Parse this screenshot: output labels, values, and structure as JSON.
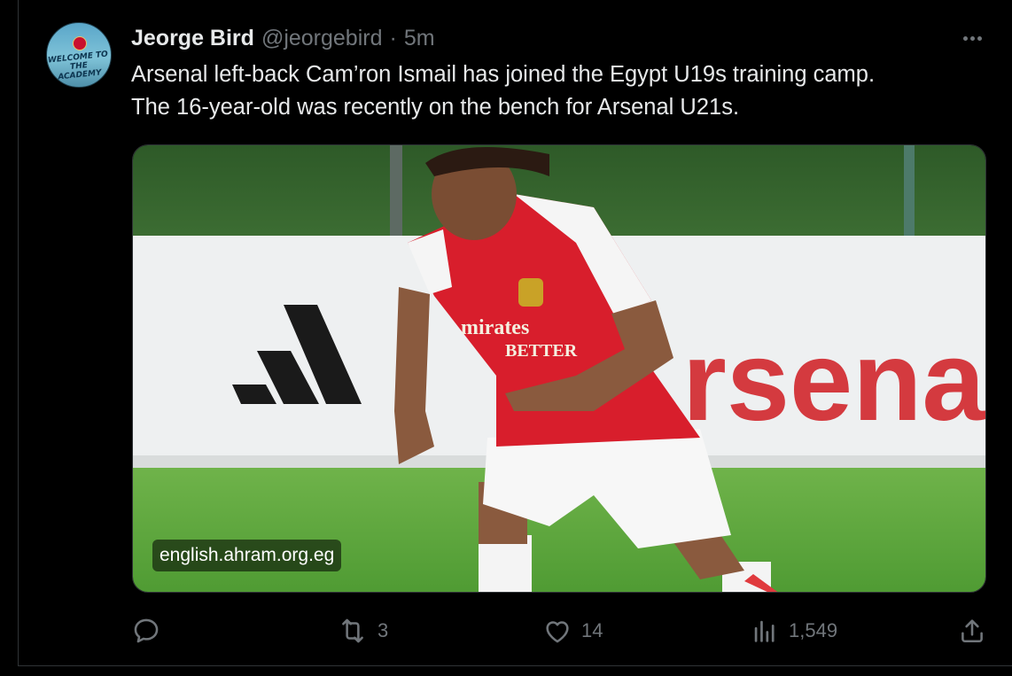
{
  "tweet": {
    "author_name": "Jeorge Bird",
    "handle": "@jeorgebird",
    "separator": "·",
    "time": "5m",
    "lines": [
      "Arsenal left-back Cam’ron Ismail has joined the Egypt U19s training camp.",
      "The 16-year-old was recently on the bench for Arsenal U21s."
    ],
    "avatar": {
      "sign_text": "WELCOME TO THE ACADEMY"
    },
    "media": {
      "source_label": "english.ahram.org.eg",
      "banner_text": "rsena",
      "shirt_text_1": "mirates",
      "shirt_text_2": "BETTER"
    }
  },
  "actions": {
    "reply": {
      "icon": "reply-icon",
      "count": ""
    },
    "retweet": {
      "icon": "retweet-icon",
      "count": "3"
    },
    "like": {
      "icon": "heart-icon",
      "count": "14"
    },
    "views": {
      "icon": "views-icon",
      "count": "1,549"
    },
    "share": {
      "icon": "share-icon"
    }
  },
  "colors": {
    "background": "#000000",
    "text_primary": "#e7e9ea",
    "text_secondary": "#71767b",
    "arsenal_red": "#c8102e"
  }
}
